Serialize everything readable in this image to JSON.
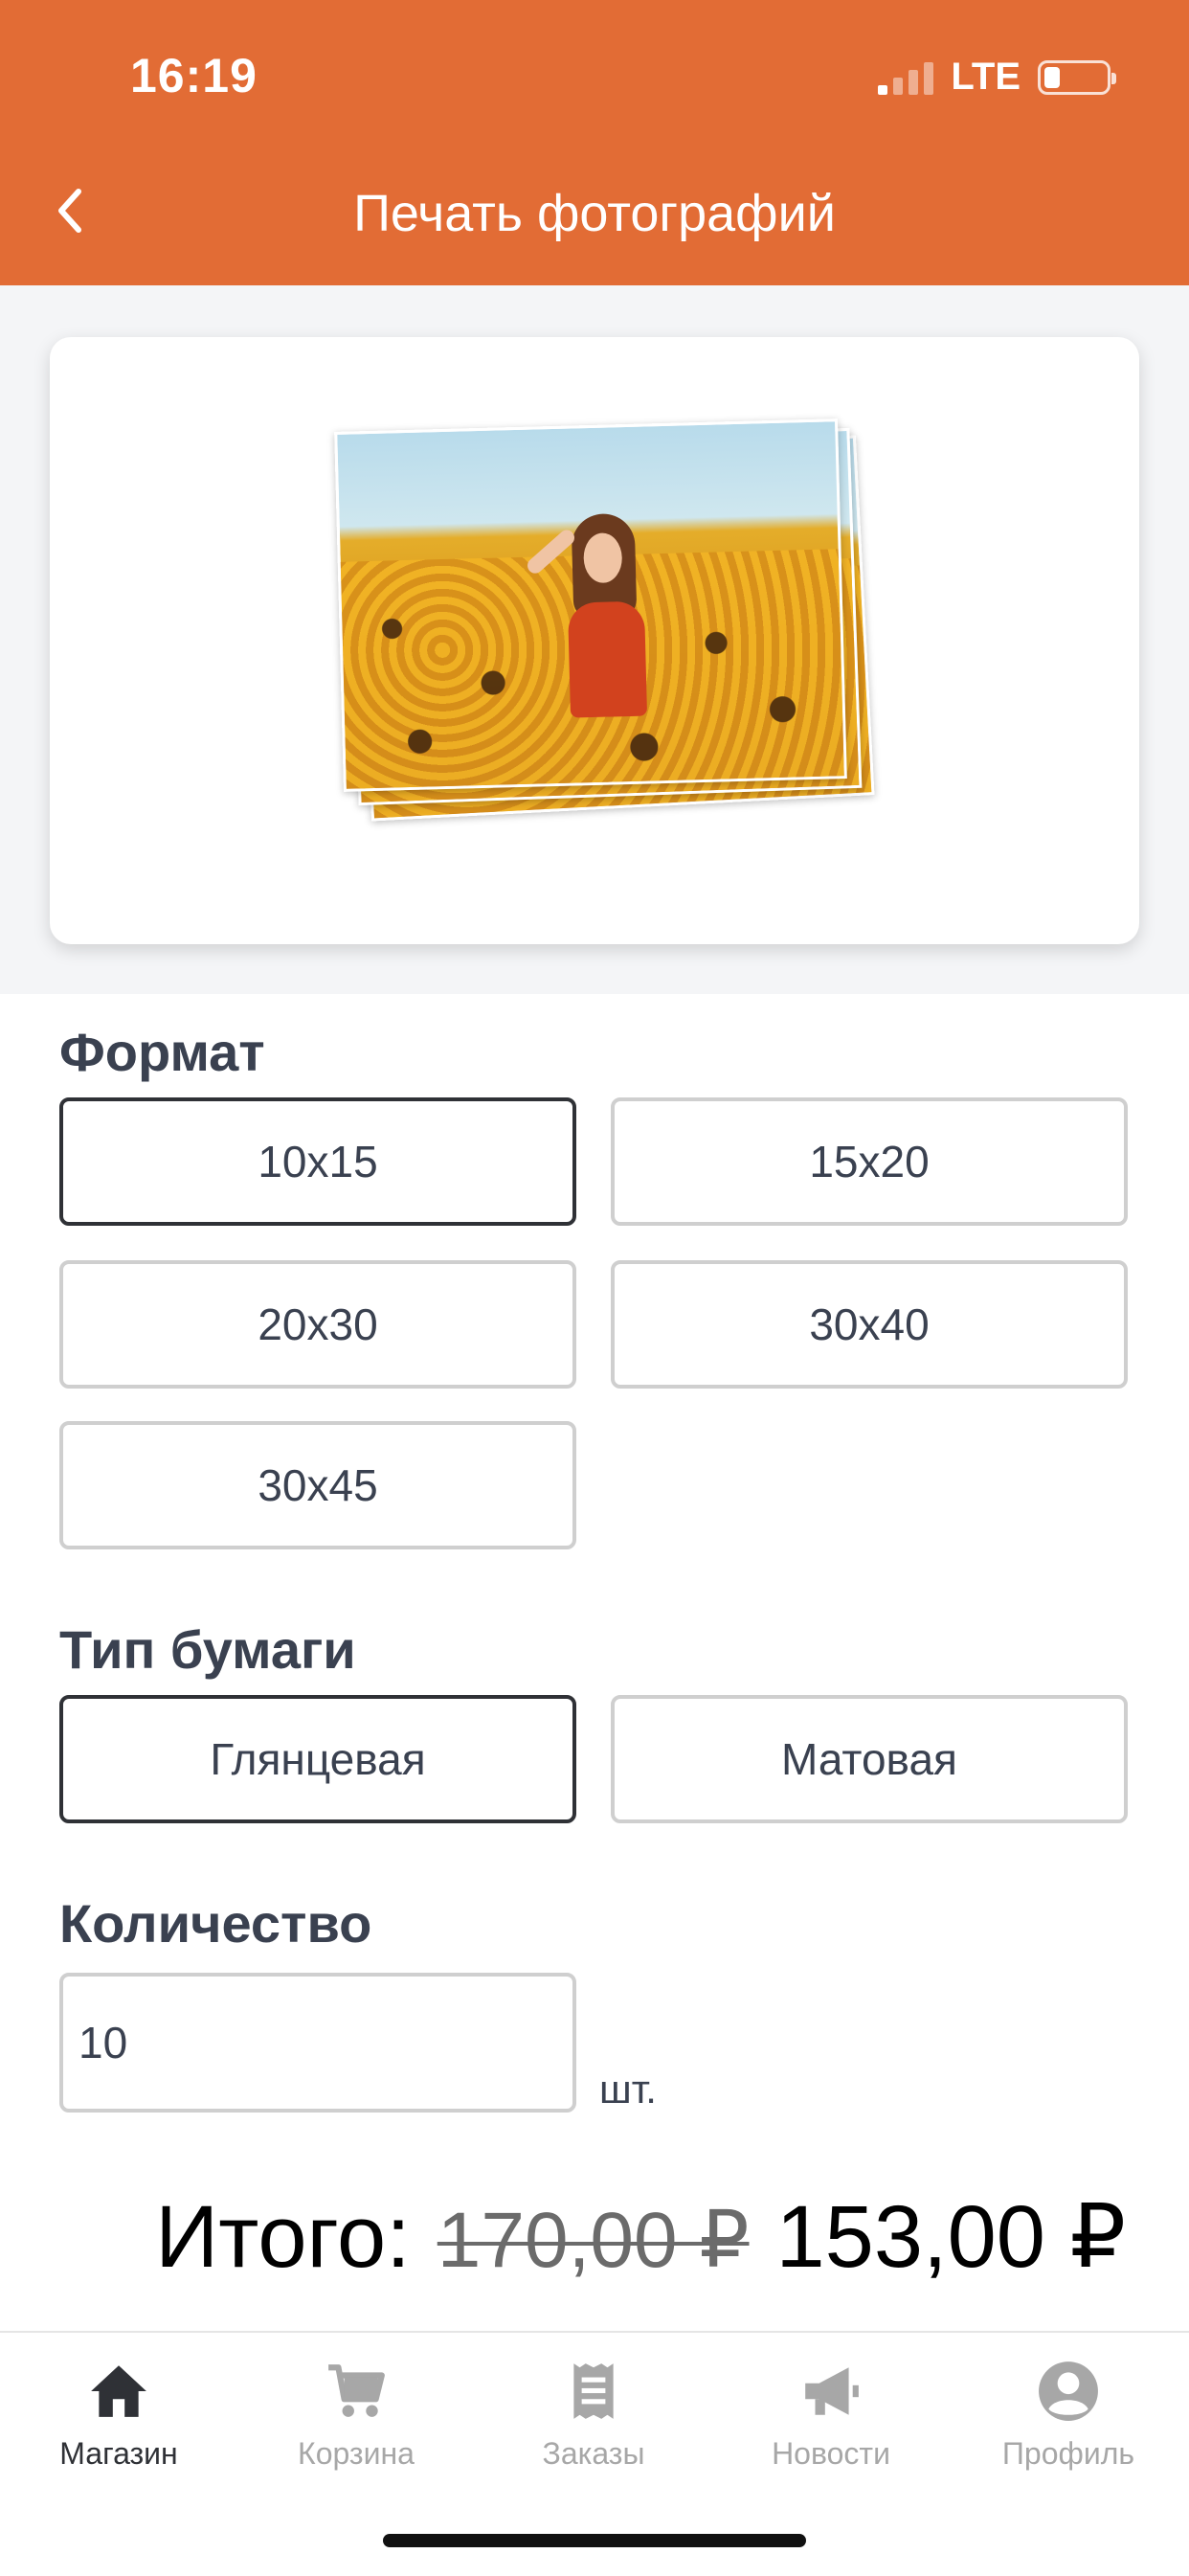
{
  "status_bar": {
    "time": "16:19",
    "network": "LTE"
  },
  "header": {
    "title": "Печать фотографий",
    "back_icon": "chevron-left-icon"
  },
  "sections": {
    "format": {
      "title": "Формат",
      "options": [
        "10x15",
        "15x20",
        "20x30",
        "30x40",
        "30x45"
      ],
      "selected": "10x15"
    },
    "paper": {
      "title": "Тип бумаги",
      "options": [
        "Глянцевая",
        "Матовая"
      ],
      "selected": "Глянцевая"
    },
    "quantity": {
      "title": "Количество",
      "value": "10",
      "unit": "шт."
    }
  },
  "total": {
    "label": "Итого:",
    "old_price": "170,00 ₽",
    "price": "153,00 ₽"
  },
  "tabbar": {
    "items": [
      {
        "label": "Магазин",
        "icon": "home-icon",
        "active": true
      },
      {
        "label": "Корзина",
        "icon": "cart-icon",
        "active": false
      },
      {
        "label": "Заказы",
        "icon": "receipt-icon",
        "active": false
      },
      {
        "label": "Новости",
        "icon": "megaphone-icon",
        "active": false
      },
      {
        "label": "Профиль",
        "icon": "profile-icon",
        "active": false
      }
    ]
  },
  "colors": {
    "accent": "#e26c35",
    "selected_border": "#2f3136",
    "tab_inactive": "#a7a7a7"
  }
}
